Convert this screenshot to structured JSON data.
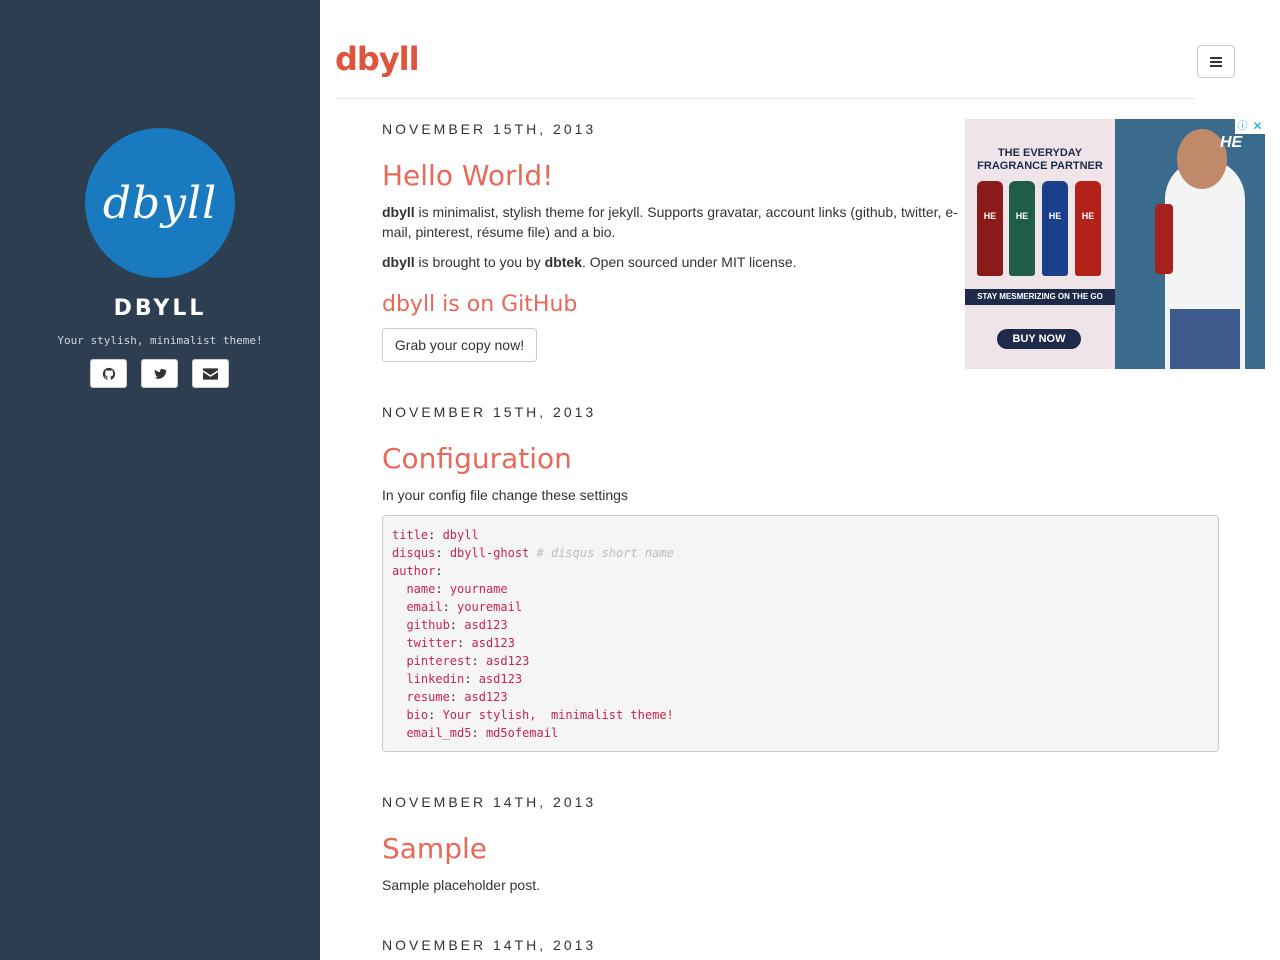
{
  "sidebar": {
    "avatar_text": "dbyll",
    "site_name": "DBYLL",
    "bio": "Your stylish, minimalist theme!",
    "social_icons": [
      "github-icon",
      "twitter-icon",
      "envelope-icon"
    ]
  },
  "header": {
    "brand": "dbyll",
    "menu_icon": "hamburger-icon"
  },
  "posts": [
    {
      "date": "NOVEMBER 15TH, 2013",
      "title": "Hello World!",
      "p1_bold": "dbyll",
      "p1_text": " is minimalist, stylish theme for jekyll. Supports gravatar, account links (github, twitter, e-mail, pinterest, résume file) and a bio.",
      "p2_bold1": "dbyll",
      "p2_text1": " is brought to you by ",
      "p2_bold2": "dbtek",
      "p2_text2": ". Open sourced under MIT license.",
      "subtitle": "dbyll is on GitHub",
      "button": "Grab your copy now!"
    },
    {
      "date": "NOVEMBER 15TH, 2013",
      "title": "Configuration",
      "intro": "In your config file change these settings",
      "code_lines": [
        {
          "key": "title",
          "value": "dbyll",
          "comment": ""
        },
        {
          "key": "disqus",
          "value": "dbyll-ghost",
          "comment": "# disqus short name"
        },
        {
          "key": "author",
          "value": "",
          "comment": ""
        },
        {
          "key": "  name",
          "value": "yourname",
          "comment": ""
        },
        {
          "key": "  email",
          "value": "youremail",
          "comment": ""
        },
        {
          "key": "  github",
          "value": "asd123",
          "comment": ""
        },
        {
          "key": "  twitter",
          "value": "asd123",
          "comment": ""
        },
        {
          "key": "  pinterest",
          "value": "asd123",
          "comment": ""
        },
        {
          "key": "  linkedin",
          "value": "asd123",
          "comment": ""
        },
        {
          "key": "  resume",
          "value": "asd123",
          "comment": ""
        },
        {
          "key": "  bio",
          "value": "Your stylish,  minimalist theme!",
          "comment": ""
        },
        {
          "key": "  email_md5",
          "value": "md5ofemail",
          "comment": ""
        }
      ]
    },
    {
      "date": "NOVEMBER 14TH, 2013",
      "title": "Sample",
      "text": "Sample placeholder post."
    },
    {
      "date": "NOVEMBER 14TH, 2013"
    }
  ],
  "ad": {
    "tagline": "THE EVERYDAY FRAGRANCE PARTNER",
    "strip": "STAY MESMERIZING ON THE GO",
    "cta": "BUY NOW",
    "logo": "HE",
    "cans": [
      {
        "label": "HE",
        "color": "#8b1a1a"
      },
      {
        "label": "HE",
        "color": "#1f5c4a"
      },
      {
        "label": "HE",
        "color": "#1a3f8b"
      },
      {
        "label": "HE",
        "color": "#b32218"
      }
    ]
  }
}
